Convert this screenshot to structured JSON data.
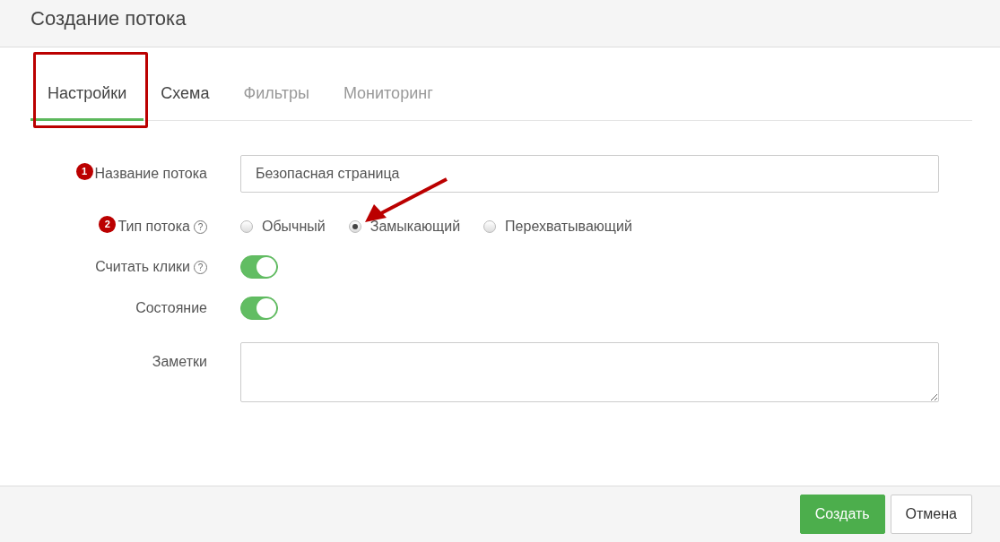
{
  "window": {
    "title": "Создание потока"
  },
  "tabs": [
    {
      "label": "Настройки",
      "selected": true,
      "disabled": false,
      "highlighted": true
    },
    {
      "label": "Схема",
      "selected": false,
      "disabled": false,
      "highlighted": false
    },
    {
      "label": "Фильтры",
      "selected": false,
      "disabled": true,
      "highlighted": false
    },
    {
      "label": "Мониторинг",
      "selected": false,
      "disabled": true,
      "highlighted": false
    }
  ],
  "fields": [
    {
      "kind": "text",
      "label": "Название потока",
      "marker": "1",
      "value": "Безопасная страница"
    },
    {
      "kind": "radio",
      "label": "Тип потока",
      "marker": "2",
      "help": "?",
      "options": [
        {
          "label": "Обычный",
          "selected": false
        },
        {
          "label": "Замыкающий",
          "selected": true,
          "pointed": true
        },
        {
          "label": "Перехватывающий",
          "selected": false
        }
      ]
    },
    {
      "kind": "switch",
      "label": "Считать клики",
      "help": "?",
      "on": true
    },
    {
      "kind": "switch",
      "label": "Состояние",
      "on": true
    },
    {
      "kind": "textarea",
      "label": "Заметки"
    }
  ],
  "buttons": [
    {
      "label": "Создать",
      "kind": "primary"
    },
    {
      "label": "Отмена",
      "kind": "secondary"
    }
  ]
}
